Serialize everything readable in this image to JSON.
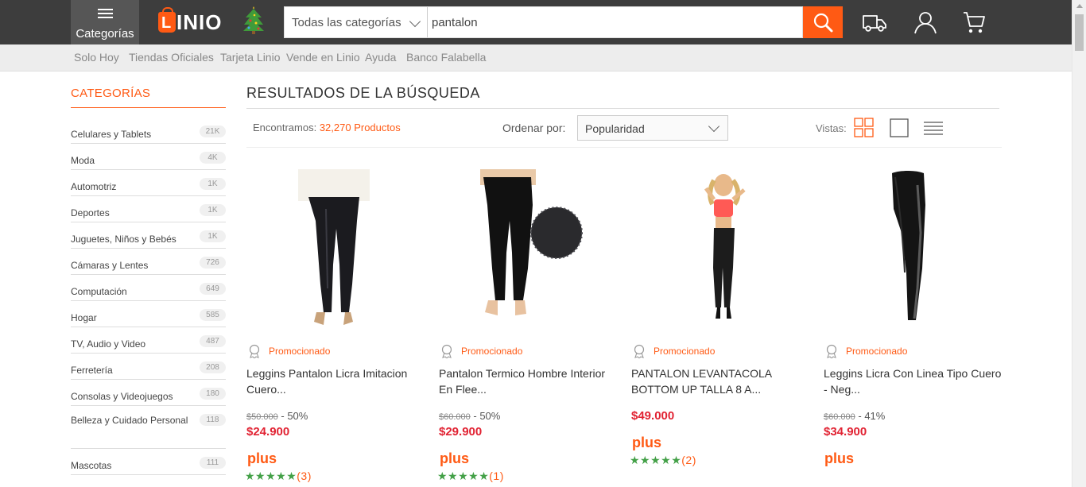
{
  "header": {
    "categories_label": "Categorías",
    "logo_letter": "L",
    "logo_word": "INIO",
    "search_category": "Todas las categorías",
    "search_value": "pantalon",
    "icons": [
      "menu-icon",
      "search-icon",
      "truck-icon",
      "user-icon",
      "cart-icon",
      "christmas-tree-icon"
    ]
  },
  "subnav": [
    "Solo Hoy",
    "Tiendas Oficiales",
    "Tarjeta Linio",
    "Vende en Linio",
    "Ayuda",
    "Banco Falabella"
  ],
  "sidebar": {
    "title": "CATEGORÍAS",
    "items": [
      {
        "label": "Celulares y Tablets",
        "count": "21K"
      },
      {
        "label": "Moda",
        "count": "4K"
      },
      {
        "label": "Automotriz",
        "count": "1K"
      },
      {
        "label": "Deportes",
        "count": "1K"
      },
      {
        "label": "Juguetes, Niños y Bebés",
        "count": "1K"
      },
      {
        "label": "Cámaras y Lentes",
        "count": "726"
      },
      {
        "label": "Computación",
        "count": "649"
      },
      {
        "label": "Hogar",
        "count": "585"
      },
      {
        "label": "TV, Audio y Video",
        "count": "487"
      },
      {
        "label": "Ferretería",
        "count": "208"
      },
      {
        "label": "Consolas y Videojuegos",
        "count": "180"
      },
      {
        "label": "Belleza y Cuidado Personal",
        "count": "118"
      },
      {
        "label": "Mascotas",
        "count": "111"
      }
    ]
  },
  "results": {
    "title": "RESULTADOS DE LA BÚSQUEDA",
    "found_label": "Encontramos:",
    "found_count": "32,270 Productos",
    "order_label": "Ordenar por:",
    "order_value": "Popularidad",
    "views_label": "Vistas:"
  },
  "products": [
    {
      "promo": "Promocionado",
      "title": "Leggins Pantalon Licra Imitacion Cuero...",
      "old_price": "$50.000",
      "discount": " - 50%",
      "price": "$24.900",
      "plus": "plus",
      "stars": "★★★★★",
      "reviews": "(3)"
    },
    {
      "promo": "Promocionado",
      "title": "Pantalon Termico Hombre Interior En Flee...",
      "old_price": "$60.000",
      "discount": " - 50%",
      "price": "$29.900",
      "plus": "plus",
      "stars": "★★★★★",
      "reviews": "(1)"
    },
    {
      "promo": "Promocionado",
      "title": "PANTALON LEVANTACOLA BOTTOM UP TALLA 8 A...",
      "old_price": "",
      "discount": "",
      "price": "$49.000",
      "plus": "plus",
      "stars": "★★★★★",
      "reviews": "(2)"
    },
    {
      "promo": "Promocionado",
      "title": "Leggins Licra Con Linea Tipo Cuero - Neg...",
      "old_price": "$60.000",
      "discount": " - 41%",
      "price": "$34.900",
      "plus": "plus",
      "stars": "",
      "reviews": ""
    }
  ],
  "colors": {
    "brand_orange": "#ff5a14",
    "price_red": "#e12232",
    "star_green": "#43a047",
    "topbar": "#3d3d3d"
  }
}
